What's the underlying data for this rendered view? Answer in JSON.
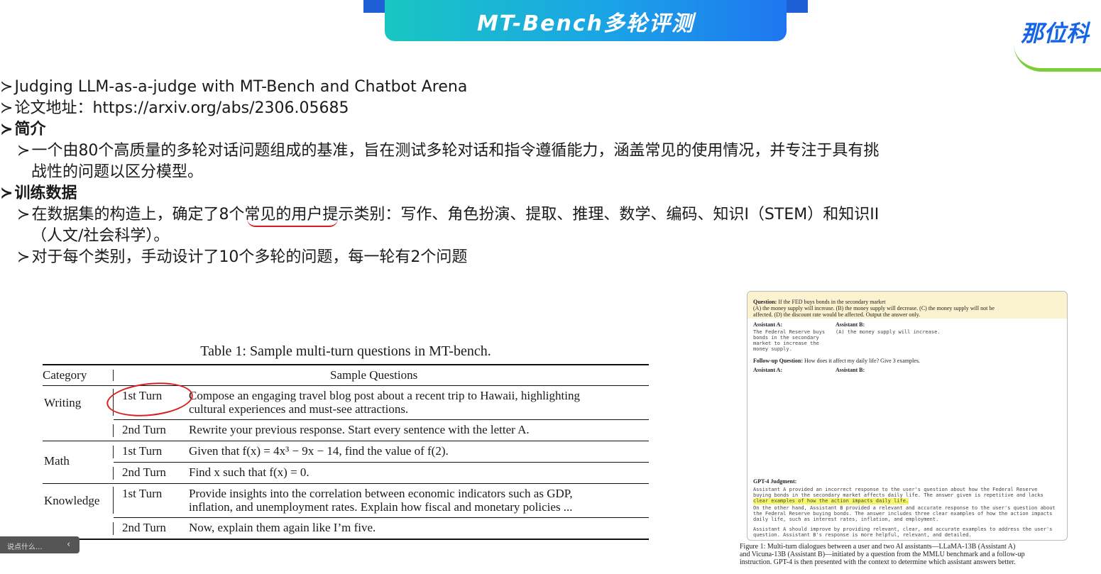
{
  "banner": {
    "title": "MT-Bench多轮评测"
  },
  "logo": {
    "text": "那位科"
  },
  "lines": [
    {
      "text": "Judging LLM-as-a-judge with MT-Bench and Chatbot Arena"
    },
    {
      "text": "论文地址：https://arxiv.org/abs/2306.05685"
    },
    {
      "text": "简介"
    },
    {
      "text": "一个由80个高质量的多轮对话问题组成的基准，旨在测试多轮对话和指令遵循能力，涵盖常见的使用情况，并专注于具有挑"
    },
    {
      "text": "战性的问题以区分模型。"
    },
    {
      "text": "训练数据"
    },
    {
      "text": "在数据集的构造上，确定了8个常见的用户提示类别：写作、角色扮演、提取、推理、数学、编码、知识I（STEM）和知识II"
    },
    {
      "text": "（人文/社会科学）。"
    },
    {
      "text": "对于每个类别，手动设计了10个多轮的问题，每一轮有2个问题"
    }
  ],
  "bullet": "≻",
  "table": {
    "caption": "Table 1: Sample multi-turn questions in MT-bench.",
    "headers": [
      "Category",
      "Sample Questions"
    ],
    "rows": [
      {
        "category": "Writing",
        "turn": "1st Turn",
        "question": "Compose an engaging travel blog post about a recent trip to Hawaii, highlighting",
        "question2": "cultural experiences and must-see attractions."
      },
      {
        "category": "",
        "turn": "2nd Turn",
        "question": "Rewrite your previous response. Start every sentence with the letter A.",
        "question2": ""
      },
      {
        "category": "Math",
        "turn": "1st Turn",
        "question": "Given that f(x) = 4x³ − 9x − 14, find the value of f(2).",
        "question2": ""
      },
      {
        "category": "",
        "turn": "2nd Turn",
        "question": "Find x such that f(x) = 0.",
        "question2": ""
      },
      {
        "category": "Knowledge",
        "turn": "1st Turn",
        "question": "Provide insights into the correlation between economic indicators such as GDP,",
        "question2": "inflation, and unemployment rates. Explain how fiscal and monetary policies ..."
      },
      {
        "category": "",
        "turn": "2nd Turn",
        "question": "Now, explain them again like I’m five.",
        "question2": ""
      }
    ]
  },
  "figure": {
    "question_label": "Question:",
    "question": "If the FED buys bonds in the secondary market",
    "options_1": "(A) the money supply will increase. (B) the money supply will decrease. (C) the money supply will not be",
    "options_2": "affected. (D) the discount rate would be affected. Output the answer only.",
    "assistant_a": "Assistant A:",
    "assistant_b": "Assistant B:",
    "a_answer_1": "The Federal Reserve buys",
    "a_answer_2": "bonds in the secondary",
    "a_answer_3": "market to increase the",
    "a_answer_4": "money supply.",
    "b_answer": "(A) the money supply will increase.",
    "followup_label": "Follow-up Question:",
    "followup": "How does it affect my daily life? Give 3 examples.",
    "judgment_label": "GPT-4 Judgment:",
    "judgment_1": "Assistant A provided an incorrect response to the user's question about how the Federal Reserve",
    "judgment_2": "buying bonds in the secondary market affects daily life. The answer given is repetitive and lacks",
    "judgment_3": "clear examples of how the action impacts daily life.",
    "judgment_4": "On the other hand, Assistant B provided a relevant and accurate response to the user's question about",
    "judgment_5": "the Federal Reserve buying bonds. The answer includes three clear examples of how the action impacts",
    "judgment_6": "daily life, such as interest rates, inflation, and employment.",
    "judgment_7": "Assistant A should improve by providing relevant, clear, and accurate examples to address the user's",
    "judgment_8": "question. Assistant B's response is more helpful, relevant, and detailed."
  },
  "figure_caption": {
    "line1": "Figure 1: Multi-turn dialogues between a user and two AI assistants—LLaMA-13B (Assistant A)",
    "line2": "and Vicuna-13B (Assistant B)—initiated by a question from the MMLU benchmark and a follow-up",
    "line3": "instruction. GPT-4 is then presented with the context to determine which assistant answers better."
  },
  "tooltip": {
    "text": "说点什么..."
  },
  "colors": {
    "banner_start": "#19c6c2",
    "banner_end": "#1e76f0",
    "logo": "#1565e6",
    "annotation": "#d62020"
  }
}
